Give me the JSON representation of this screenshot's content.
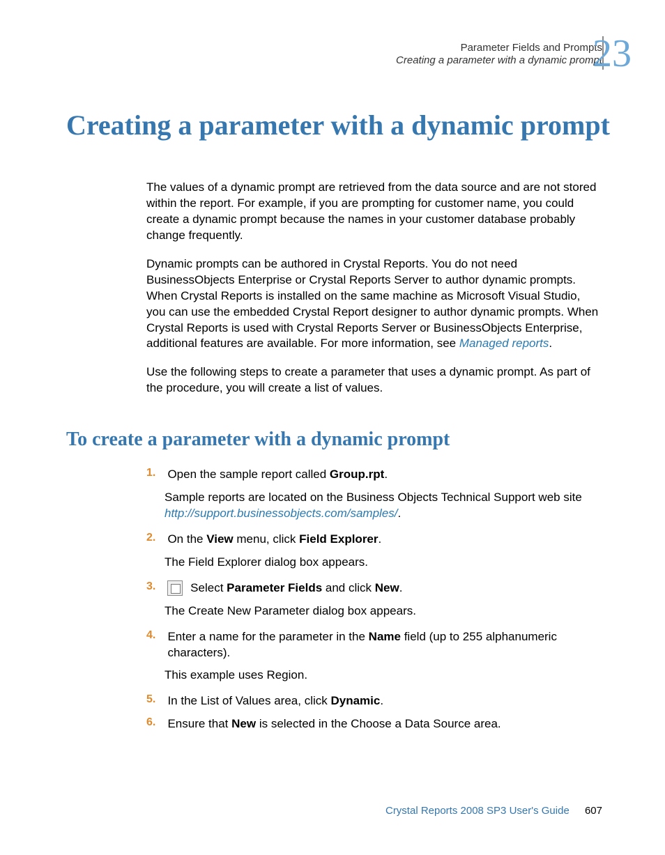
{
  "header": {
    "line1": "Parameter Fields and Prompts",
    "line2": "Creating a parameter with a dynamic prompt",
    "chapter": "23"
  },
  "title": "Creating a parameter with a dynamic prompt",
  "paragraphs": {
    "p1": "The values of a dynamic prompt are retrieved from the data source and are not stored within the report. For example, if you are prompting for customer name, you could create a dynamic prompt because the names in your customer database probably change frequently.",
    "p2a": "Dynamic prompts can be authored in Crystal Reports. You do not need BusinessObjects Enterprise or Crystal Reports Server to author dynamic prompts. When Crystal Reports is installed on the same machine as Microsoft Visual Studio, you can use the embedded Crystal Report designer to author dynamic prompts. When Crystal Reports is used with Crystal Reports Server or BusinessObjects Enterprise, additional features are available. For more information, see ",
    "p2link": "Managed reports",
    "p2b": ".",
    "p3": "Use the following steps to create a parameter that uses a dynamic prompt. As part of the procedure, you will create a list of values."
  },
  "subtitle": "To create a parameter with a dynamic prompt",
  "steps": {
    "s1": {
      "num": "1.",
      "pre": "Open the sample report called ",
      "bold": "Group.rpt",
      "post": ".",
      "sub_pre": "Sample reports are located on the Business Objects Technical Support web site ",
      "sub_link": "http://support.businessobjects.com/samples/",
      "sub_post": "."
    },
    "s2": {
      "num": "2.",
      "pre": "On the ",
      "bold1": "View",
      "mid": " menu, click ",
      "bold2": "Field Explorer",
      "post": ".",
      "sub": "The Field Explorer dialog box appears."
    },
    "s3": {
      "num": "3.",
      "pre": " Select ",
      "bold1": "Parameter Fields",
      "mid": " and click ",
      "bold2": "New",
      "post": ".",
      "sub": "The Create New Parameter dialog box appears."
    },
    "s4": {
      "num": "4.",
      "pre": "Enter a name for the parameter in the ",
      "bold": "Name",
      "post": " field (up to 255 alphanumeric characters).",
      "sub": "This example uses Region."
    },
    "s5": {
      "num": "5.",
      "pre": "In the List of Values area, click ",
      "bold": "Dynamic",
      "post": "."
    },
    "s6": {
      "num": "6.",
      "pre": "Ensure that ",
      "bold": "New",
      "post": " is selected in the Choose a Data Source area."
    }
  },
  "footer": {
    "guide": "Crystal Reports 2008 SP3 User's Guide",
    "page": "607"
  }
}
